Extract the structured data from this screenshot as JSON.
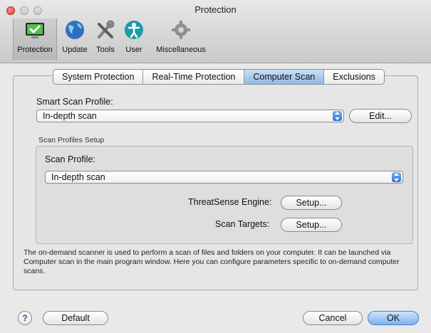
{
  "window": {
    "title": "Protection"
  },
  "toolbar": {
    "items": [
      {
        "label": "Protection",
        "icon": "monitor-check-icon",
        "selected": true
      },
      {
        "label": "Update",
        "icon": "globe-icon"
      },
      {
        "label": "Tools",
        "icon": "tools-icon"
      },
      {
        "label": "User",
        "icon": "user-icon"
      },
      {
        "label": "Miscellaneous",
        "icon": "gear-icon"
      }
    ]
  },
  "tabs": [
    {
      "label": "System Protection"
    },
    {
      "label": "Real-Time Protection"
    },
    {
      "label": "Computer Scan",
      "active": true
    },
    {
      "label": "Exclusions"
    }
  ],
  "smart_scan": {
    "label": "Smart Scan Profile:",
    "value": "In-depth scan",
    "edit_button": "Edit..."
  },
  "scan_profiles_setup": {
    "title": "Scan Profiles Setup",
    "profile_label": "Scan Profile:",
    "profile_value": "In-depth scan",
    "threatsense_label": "ThreatSense Engine:",
    "threatsense_button": "Setup...",
    "targets_label": "Scan Targets:",
    "targets_button": "Setup..."
  },
  "description": "The on-demand scanner is used to perform a scan of files and folders on your computer. It can be launched via Computer scan in the main program window. Here you can configure parameters specific to on-demand computer scans.",
  "footer": {
    "help": "?",
    "default_button": "Default",
    "cancel_button": "Cancel",
    "ok_button": "OK"
  },
  "colors": {
    "accent": "#3a78d6",
    "selected_tab": "#9fc4ec"
  }
}
